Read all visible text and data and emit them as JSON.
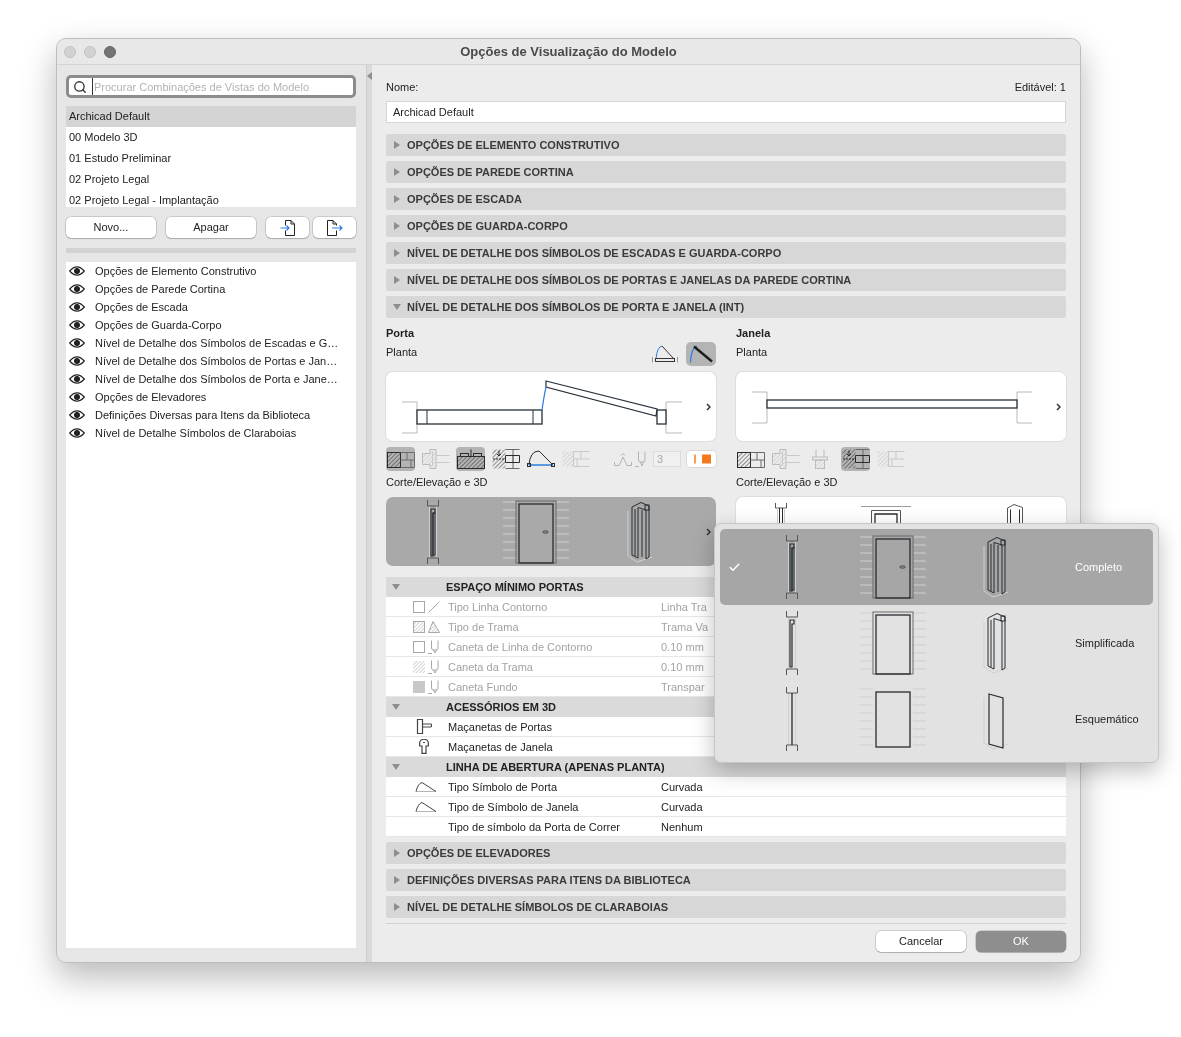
{
  "window": {
    "title": "Opções de Visualização do Modelo"
  },
  "sidebar": {
    "search": {
      "placeholder": "Procurar Combinações de Vistas do Modelo"
    },
    "combinations": [
      {
        "label": "Archicad Default",
        "selected": true
      },
      {
        "label": "00 Modelo 3D",
        "selected": false
      },
      {
        "label": "01 Estudo Preliminar",
        "selected": false
      },
      {
        "label": "02 Projeto Legal",
        "selected": false
      },
      {
        "label": "02 Projeto Legal - Implantação",
        "selected": false
      }
    ],
    "buttons": [
      {
        "kind": "text",
        "label": "Novo..."
      },
      {
        "kind": "text",
        "label": "Apagar"
      },
      {
        "kind": "import"
      },
      {
        "kind": "export"
      }
    ],
    "option_sets": [
      {
        "label": "Opções de Elemento Construtivo",
        "visible": true
      },
      {
        "label": "Opções de Parede Cortina",
        "visible": true
      },
      {
        "label": "Opções de Escada",
        "visible": true
      },
      {
        "label": "Opções de Guarda-Corpo",
        "visible": true
      },
      {
        "label": "Nível de Detalhe dos Símbolos de Escadas e G…",
        "visible": true
      },
      {
        "label": "Nível de Detalhe dos Símbolos de Portas e Jan…",
        "visible": true
      },
      {
        "label": "Nível de Detalhe dos Símbolos de Porta e Jane…",
        "visible": true
      },
      {
        "label": "Opções de Elevadores",
        "visible": true
      },
      {
        "label": "Definições Diversas para Itens da Biblioteca",
        "visible": true
      },
      {
        "label": "Nível de Detalhe Símbolos de Claraboias",
        "visible": true
      }
    ]
  },
  "name_field": {
    "label": "Nome:",
    "value": "Archicad Default"
  },
  "editable": "Editável: 1",
  "sections": [
    {
      "title": "OPÇÕES DE ELEMENTO CONSTRUTIVO",
      "expanded": false
    },
    {
      "title": "OPÇÕES DE PAREDE CORTINA",
      "expanded": false
    },
    {
      "title": "OPÇÕES DE ESCADA",
      "expanded": false
    },
    {
      "title": "OPÇÕES DE GUARDA-CORPO",
      "expanded": false
    },
    {
      "title": "NÍVEL DE DETALHE DOS SÍMBOLOS DE ESCADAS E GUARDA-CORPO",
      "expanded": false
    },
    {
      "title": "NÍVEL DE DETALHE DOS SÍMBOLOS DE PORTAS E JANELAS DA PAREDE CORTINA",
      "expanded": false
    },
    {
      "title": "NÍVEL DE DETALHE DOS SÍMBOLOS DE PORTA E JANELA (INT)",
      "expanded": true,
      "content": {
        "columns": [
          {
            "kind": "door",
            "title": "Porta",
            "plan_label": "Planta",
            "plan_styles": [
              {
                "kind": "symbol",
                "selected": false
              },
              {
                "kind": "leaf",
                "selected": true
              }
            ],
            "plan_options": [
              {
                "kind": "cut-fill",
                "selected": true,
                "disabled": false
              },
              {
                "kind": "frame",
                "selected": false,
                "disabled": true
              },
              {
                "kind": "threshold",
                "selected": true,
                "disabled": false
              },
              {
                "kind": "reveal",
                "selected": false,
                "disabled": false
              },
              {
                "kind": "swing",
                "selected": false,
                "disabled": false
              },
              {
                "kind": "plain-wall",
                "selected": false,
                "disabled": true
              }
            ],
            "pen": {
              "value": "3",
              "disabled": true
            },
            "section_label": "Corte/Elevação e 3D",
            "section_preview": {
              "pressed": true
            }
          },
          {
            "kind": "window",
            "title": "Janela",
            "plan_label": "Planta",
            "plan_options": [
              {
                "kind": "cut-fill",
                "selected": false,
                "disabled": false
              },
              {
                "kind": "frame",
                "selected": false,
                "disabled": true
              },
              {
                "kind": "sill",
                "selected": false,
                "disabled": true
              },
              {
                "kind": "reveal",
                "selected": true,
                "disabled": false
              },
              {
                "kind": "plain-wall",
                "selected": false,
                "disabled": true
              }
            ],
            "section_label": "Corte/Elevação e 3D",
            "section_preview": {
              "pressed": false
            }
          }
        ],
        "property_groups": [
          {
            "title": "ESPAÇO MÍNIMO PORTAS",
            "expanded": true,
            "rows": [
              {
                "kind": "outline-line",
                "label": "Tipo Linha Contorno",
                "value": "Linha Tra",
                "disabled": true
              },
              {
                "kind": "fill-type",
                "label": "Tipo de Trama",
                "value": "Trama Va",
                "disabled": true
              },
              {
                "kind": "outline-pen",
                "label": "Caneta de Linha de Contorno",
                "value": "0.10 mm",
                "disabled": true
              },
              {
                "kind": "fill-pen",
                "label": "Caneta da Trama",
                "value": "0.10 mm",
                "disabled": true
              },
              {
                "kind": "background-pen",
                "label": "Caneta Fundo",
                "value": "Transpar",
                "disabled": true
              }
            ]
          },
          {
            "title": "ACESSÓRIOS EM 3D",
            "expanded": true,
            "rows": [
              {
                "kind": "door-handle",
                "label": "Maçanetas de Portas",
                "disabled": false
              },
              {
                "kind": "window-handle",
                "label": "Maçanetas de Janela",
                "disabled": false
              }
            ]
          },
          {
            "title": "LINHA DE ABERTURA (APENAS PLANTA)",
            "expanded": true,
            "rows": [
              {
                "kind": "opening-line",
                "label": "Tipo Símbolo de Porta",
                "value": "Curvada",
                "disabled": false
              },
              {
                "kind": "opening-line",
                "label": "Tipo de Símbolo de Janela",
                "value": "Curvada",
                "disabled": false
              },
              {
                "kind": "none",
                "label": "Tipo de símbolo da Porta de Correr",
                "value": "Nenhum",
                "disabled": false
              }
            ]
          }
        ]
      }
    },
    {
      "title": "OPÇÕES DE ELEVADORES",
      "expanded": false
    },
    {
      "title": "DEFINIÇÕES DIVERSAS PARA ITENS DA BIBLIOTECA",
      "expanded": false
    },
    {
      "title": "NÍVEL DE DETALHE SÍMBOLOS DE CLARABOIAS",
      "expanded": false
    }
  ],
  "detail_menu": {
    "items": [
      {
        "kind": "full",
        "label": "Completo",
        "selected": true
      },
      {
        "kind": "simplified",
        "label": "Simplificada",
        "selected": false
      },
      {
        "kind": "schematic",
        "label": "Esquemático",
        "selected": false
      }
    ]
  },
  "footer_buttons": [
    {
      "label": "Cancelar",
      "default": false
    },
    {
      "label": "OK",
      "default": true
    }
  ]
}
